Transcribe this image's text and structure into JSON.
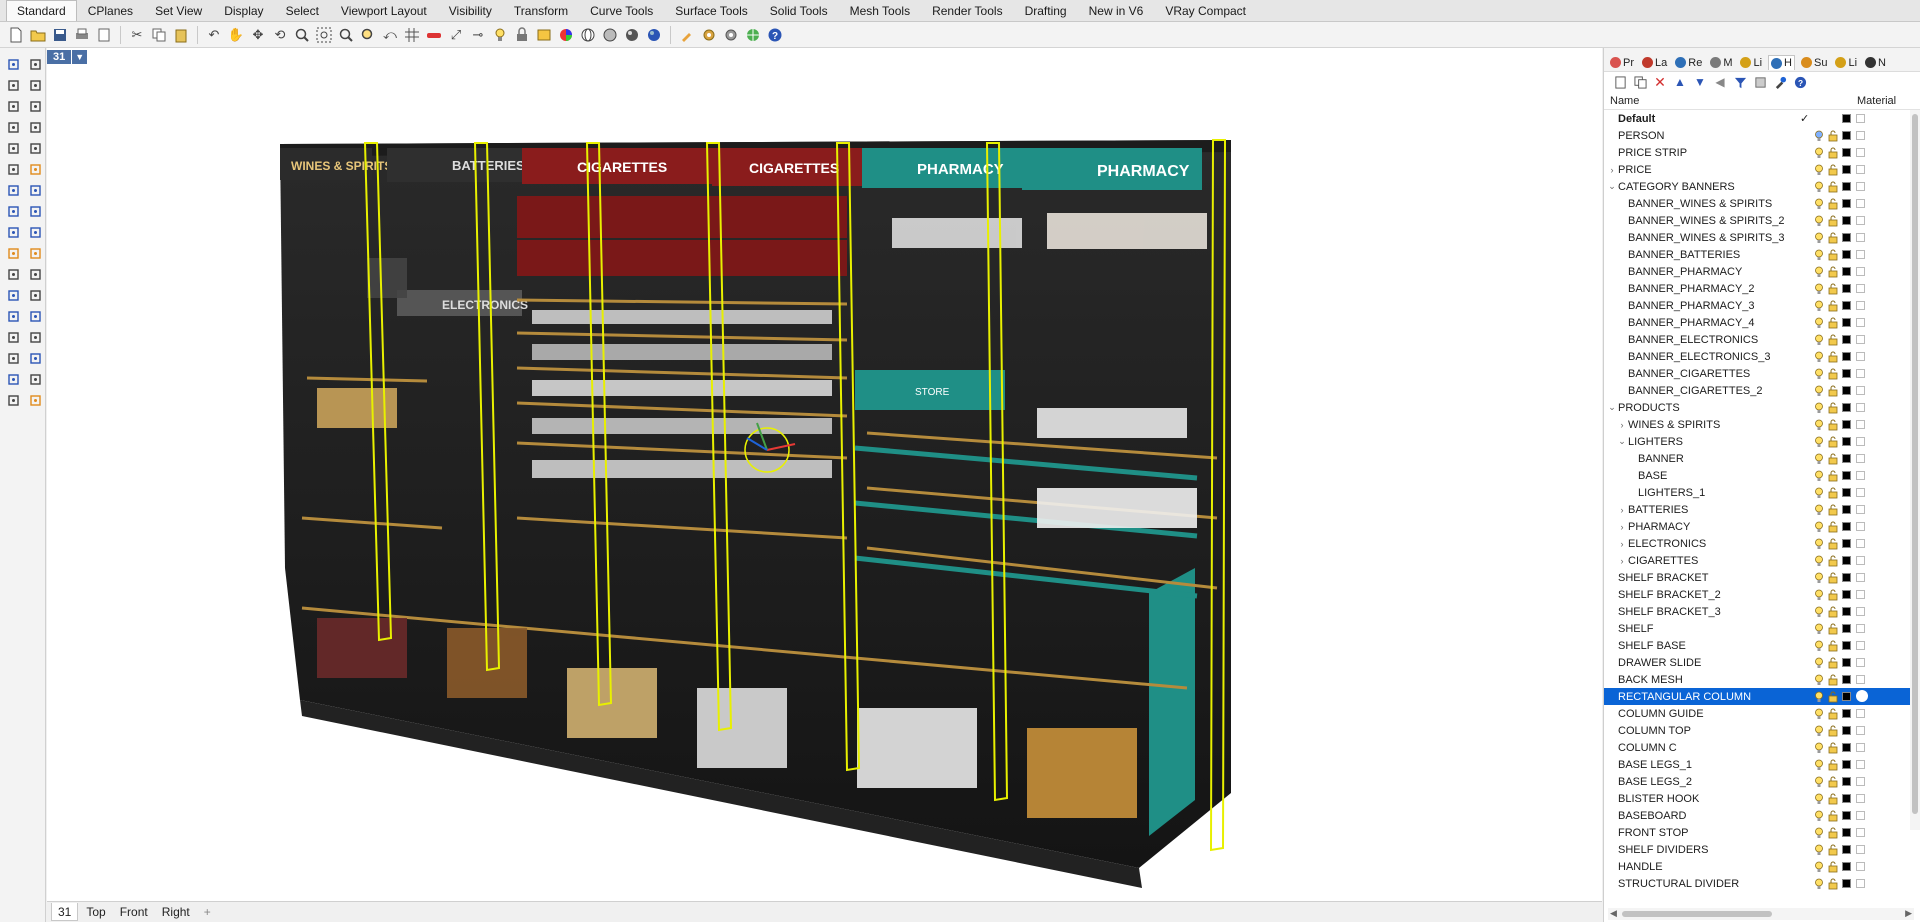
{
  "menu_tabs": [
    {
      "label": "Standard",
      "active": true
    },
    {
      "label": "CPlanes"
    },
    {
      "label": "Set View"
    },
    {
      "label": "Display"
    },
    {
      "label": "Select"
    },
    {
      "label": "Viewport Layout"
    },
    {
      "label": "Visibility"
    },
    {
      "label": "Transform"
    },
    {
      "label": "Curve Tools"
    },
    {
      "label": "Surface Tools"
    },
    {
      "label": "Solid Tools"
    },
    {
      "label": "Mesh Tools"
    },
    {
      "label": "Render Tools"
    },
    {
      "label": "Drafting"
    },
    {
      "label": "New in V6"
    },
    {
      "label": "VRay Compact"
    }
  ],
  "viewport": {
    "title": "31",
    "scene_labels": {
      "wines": "WINES & SPIRITS",
      "batteries": "BATTERIES",
      "cigarettes1": "CIGARETTES",
      "cigarettes2": "CIGARETTES",
      "pharmacy1": "PHARMACY",
      "pharmacy2": "PHARMACY",
      "electronics": "ELECTRONICS",
      "store": "STORE"
    }
  },
  "viewport_tabs": [
    {
      "label": "31",
      "active": true
    },
    {
      "label": "Top"
    },
    {
      "label": "Front"
    },
    {
      "label": "Right"
    },
    {
      "label": "+"
    }
  ],
  "panel_tabs": [
    {
      "label": "Pr",
      "color": "#d9534f"
    },
    {
      "label": "La",
      "color": "#c0392b"
    },
    {
      "label": "Re",
      "color": "#2e6fb7"
    },
    {
      "label": "M",
      "color": "#7a7a7a"
    },
    {
      "label": "Li",
      "color": "#d4a017"
    },
    {
      "label": "H",
      "color": "#2e6fb7",
      "active": true
    },
    {
      "label": "Su",
      "color": "#d98c1c"
    },
    {
      "label": "Li",
      "color": "#d4a017"
    },
    {
      "label": "N",
      "color": "#333333"
    }
  ],
  "layers_header": {
    "name": "Name",
    "material": "Material"
  },
  "layers": [
    {
      "name": "Default",
      "indent": 0,
      "bold": true,
      "current": true,
      "color": "#000000"
    },
    {
      "name": "PERSON",
      "indent": 0,
      "color": "#000000",
      "bulb": "blue"
    },
    {
      "name": "PRICE STRIP",
      "indent": 0,
      "color": "#000000"
    },
    {
      "name": "PRICE",
      "indent": 0,
      "expand": "›",
      "color": "#000000"
    },
    {
      "name": "CATEGORY BANNERS",
      "indent": 0,
      "expand": "⌄",
      "color": "#000000"
    },
    {
      "name": "BANNER_WINES & SPIRITS",
      "indent": 1,
      "color": "#000000"
    },
    {
      "name": "BANNER_WINES & SPIRITS_2",
      "indent": 1,
      "color": "#000000"
    },
    {
      "name": "BANNER_WINES & SPIRITS_3",
      "indent": 1,
      "color": "#000000"
    },
    {
      "name": "BANNER_BATTERIES",
      "indent": 1,
      "color": "#000000"
    },
    {
      "name": "BANNER_PHARMACY",
      "indent": 1,
      "color": "#000000"
    },
    {
      "name": "BANNER_PHARMACY_2",
      "indent": 1,
      "color": "#000000"
    },
    {
      "name": "BANNER_PHARMACY_3",
      "indent": 1,
      "color": "#000000"
    },
    {
      "name": "BANNER_PHARMACY_4",
      "indent": 1,
      "color": "#000000"
    },
    {
      "name": "BANNER_ELECTRONICS",
      "indent": 1,
      "color": "#000000"
    },
    {
      "name": "BANNER_ELECTRONICS_3",
      "indent": 1,
      "color": "#000000"
    },
    {
      "name": "BANNER_CIGARETTES",
      "indent": 1,
      "color": "#000000"
    },
    {
      "name": "BANNER_CIGARETTES_2",
      "indent": 1,
      "color": "#000000"
    },
    {
      "name": "PRODUCTS",
      "indent": 0,
      "expand": "⌄",
      "color": "#000000"
    },
    {
      "name": "WINES & SPIRITS",
      "indent": 1,
      "expand": "›",
      "color": "#000000"
    },
    {
      "name": "LIGHTERS",
      "indent": 1,
      "expand": "⌄",
      "color": "#000000"
    },
    {
      "name": "BANNER",
      "indent": 2,
      "color": "#000000"
    },
    {
      "name": "BASE",
      "indent": 2,
      "color": "#000000"
    },
    {
      "name": "LIGHTERS_1",
      "indent": 2,
      "color": "#000000"
    },
    {
      "name": "BATTERIES",
      "indent": 1,
      "expand": "›",
      "color": "#000000"
    },
    {
      "name": "PHARMACY",
      "indent": 1,
      "expand": "›",
      "color": "#000000"
    },
    {
      "name": "ELECTRONICS",
      "indent": 1,
      "expand": "›",
      "color": "#000000"
    },
    {
      "name": "CIGARETTES",
      "indent": 1,
      "expand": "›",
      "color": "#000000"
    },
    {
      "name": "SHELF BRACKET",
      "indent": 0,
      "color": "#000000"
    },
    {
      "name": "SHELF BRACKET_2",
      "indent": 0,
      "color": "#000000"
    },
    {
      "name": "SHELF BRACKET_3",
      "indent": 0,
      "color": "#000000"
    },
    {
      "name": "SHELF",
      "indent": 0,
      "color": "#000000"
    },
    {
      "name": "SHELF BASE",
      "indent": 0,
      "color": "#000000"
    },
    {
      "name": "DRAWER SLIDE",
      "indent": 0,
      "color": "#000000"
    },
    {
      "name": "BACK MESH",
      "indent": 0,
      "color": "#000000"
    },
    {
      "name": "RECTANGULAR COLUMN",
      "indent": 0,
      "selected": true,
      "color": "#000000"
    },
    {
      "name": "COLUMN GUIDE",
      "indent": 0,
      "color": "#000000"
    },
    {
      "name": "COLUMN TOP",
      "indent": 0,
      "color": "#000000"
    },
    {
      "name": "COLUMN C",
      "indent": 0,
      "color": "#000000"
    },
    {
      "name": "BASE LEGS_1",
      "indent": 0,
      "color": "#000000"
    },
    {
      "name": "BASE LEGS_2",
      "indent": 0,
      "color": "#000000"
    },
    {
      "name": "BLISTER HOOK",
      "indent": 0,
      "color": "#000000"
    },
    {
      "name": "BASEBOARD",
      "indent": 0,
      "color": "#000000"
    },
    {
      "name": "FRONT STOP",
      "indent": 0,
      "color": "#000000"
    },
    {
      "name": "SHELF DIVIDERS",
      "indent": 0,
      "color": "#000000"
    },
    {
      "name": "HANDLE",
      "indent": 0,
      "color": "#000000"
    },
    {
      "name": "STRUCTURAL DIVIDER",
      "indent": 0,
      "color": "#000000"
    }
  ],
  "colors": {
    "selection": "#0a64d6",
    "viewport_title": "#4a6fa5",
    "column_highlight": "#e8f000",
    "banner_red": "#8a1c1c",
    "banner_teal": "#1f8f86",
    "banner_dark": "#2b2b2b"
  }
}
